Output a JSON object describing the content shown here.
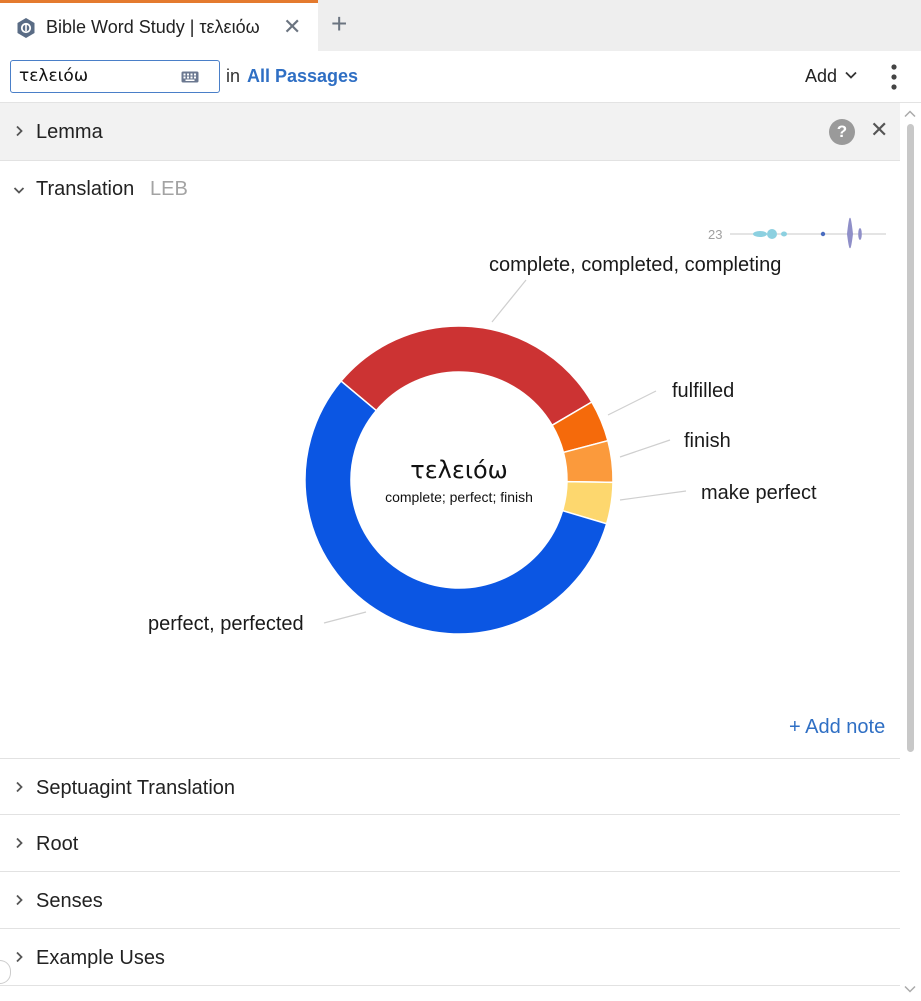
{
  "tab": {
    "title": "Bible Word Study | τελειόω"
  },
  "search": {
    "value": "τελειόω",
    "in_label": "in",
    "scope_label": "All Passages"
  },
  "toolbar": {
    "add_label": "Add"
  },
  "sections": {
    "lemma": "Lemma",
    "translation": "Translation",
    "translation_version": "LEB",
    "collapsed": [
      "Septuagint Translation",
      "Root",
      "Senses",
      "Example Uses"
    ]
  },
  "sparkline": {
    "count": "23"
  },
  "add_note_label": "+ Add note",
  "colors": {
    "accent": "#2f6fc4",
    "tab_highlight": "#e47a2e"
  },
  "chart_data": {
    "type": "pie",
    "center_title": "τελειόω",
    "center_subtitle": "complete; perfect; finish",
    "slices": [
      {
        "label": "complete, completed, completing",
        "value": 7,
        "color": "#cc3333"
      },
      {
        "label": "fulfilled",
        "value": 1,
        "color": "#f56a0b"
      },
      {
        "label": "finish",
        "value": 1,
        "color": "#fb9a3c"
      },
      {
        "label": "make perfect",
        "value": 1,
        "color": "#fdd76e"
      },
      {
        "label": "perfect, perfected",
        "value": 13,
        "color": "#0b56e3"
      }
    ]
  }
}
